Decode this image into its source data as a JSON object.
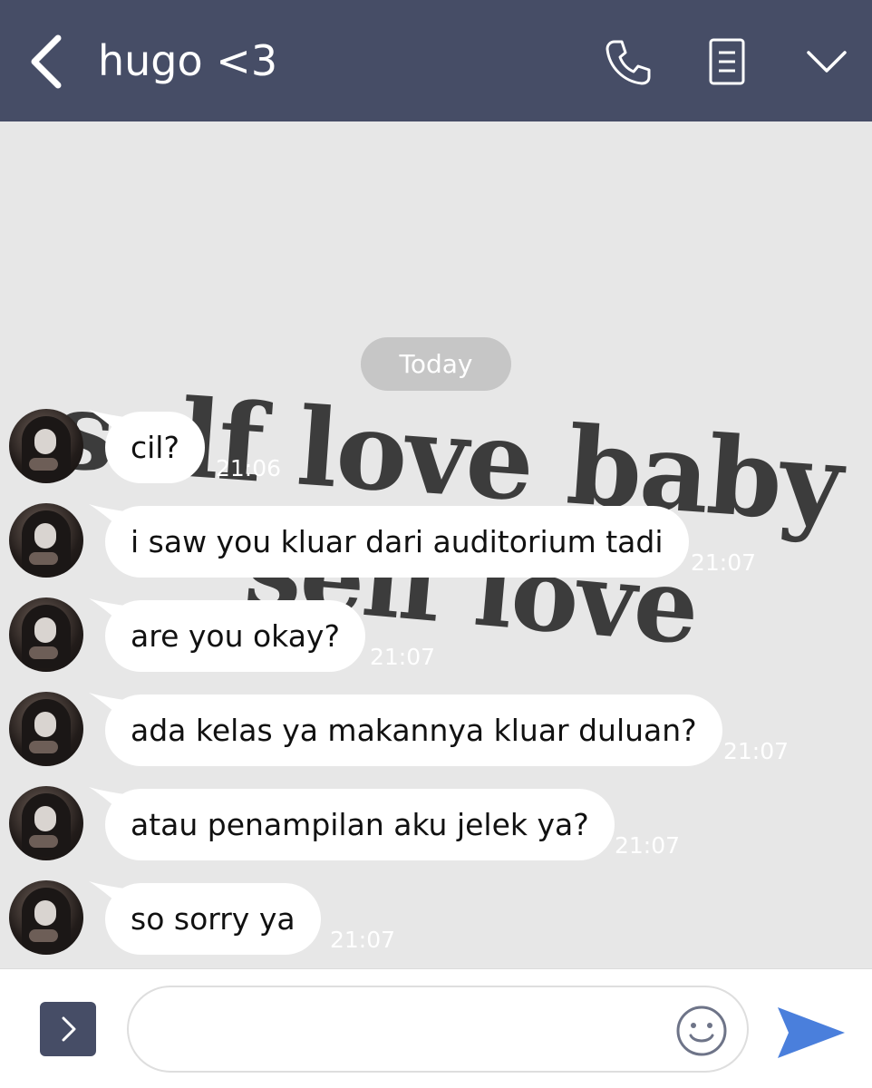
{
  "header": {
    "title": "hugo <3",
    "icons": [
      "back-chevron-icon",
      "phone-icon",
      "notes-icon",
      "chevron-down-icon"
    ],
    "background": "#464d66"
  },
  "chat": {
    "wallpaper": {
      "line1": "self love baby",
      "line2": "self love"
    },
    "date_label": "Today",
    "messages": [
      {
        "text": "cil?",
        "time": "21:06"
      },
      {
        "text": "i saw you kluar dari auditorium tadi",
        "time": "21:07"
      },
      {
        "text": "are you okay?",
        "time": "21:07"
      },
      {
        "text": "ada kelas ya makannya kluar duluan?",
        "time": "21:07"
      },
      {
        "text": "atau penampilan aku jelek ya?",
        "time": "21:07"
      },
      {
        "text": "so sorry ya",
        "time": "21:07"
      }
    ]
  },
  "input": {
    "placeholder": "",
    "value": "",
    "icons": [
      "expand-icon",
      "emoji-icon",
      "send-icon"
    ],
    "send_color": "#4a7fdc"
  }
}
